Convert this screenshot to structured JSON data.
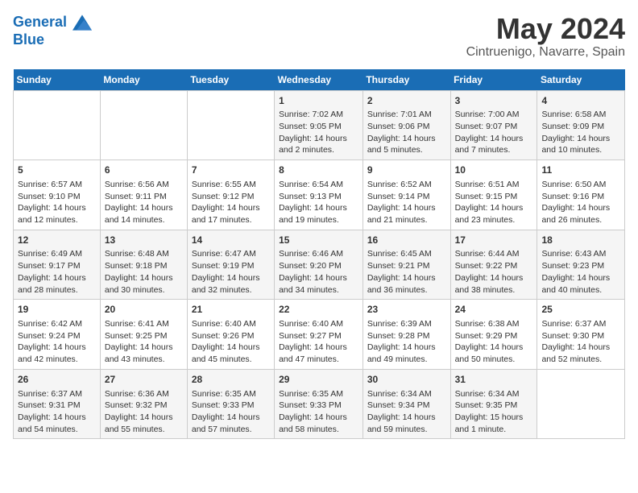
{
  "header": {
    "logo_line1": "General",
    "logo_line2": "Blue",
    "month": "May 2024",
    "location": "Cintruenigo, Navarre, Spain"
  },
  "weekdays": [
    "Sunday",
    "Monday",
    "Tuesday",
    "Wednesday",
    "Thursday",
    "Friday",
    "Saturday"
  ],
  "weeks": [
    [
      {
        "day": "",
        "content": ""
      },
      {
        "day": "",
        "content": ""
      },
      {
        "day": "",
        "content": ""
      },
      {
        "day": "1",
        "content": "Sunrise: 7:02 AM\nSunset: 9:05 PM\nDaylight: 14 hours\nand 2 minutes."
      },
      {
        "day": "2",
        "content": "Sunrise: 7:01 AM\nSunset: 9:06 PM\nDaylight: 14 hours\nand 5 minutes."
      },
      {
        "day": "3",
        "content": "Sunrise: 7:00 AM\nSunset: 9:07 PM\nDaylight: 14 hours\nand 7 minutes."
      },
      {
        "day": "4",
        "content": "Sunrise: 6:58 AM\nSunset: 9:09 PM\nDaylight: 14 hours\nand 10 minutes."
      }
    ],
    [
      {
        "day": "5",
        "content": "Sunrise: 6:57 AM\nSunset: 9:10 PM\nDaylight: 14 hours\nand 12 minutes."
      },
      {
        "day": "6",
        "content": "Sunrise: 6:56 AM\nSunset: 9:11 PM\nDaylight: 14 hours\nand 14 minutes."
      },
      {
        "day": "7",
        "content": "Sunrise: 6:55 AM\nSunset: 9:12 PM\nDaylight: 14 hours\nand 17 minutes."
      },
      {
        "day": "8",
        "content": "Sunrise: 6:54 AM\nSunset: 9:13 PM\nDaylight: 14 hours\nand 19 minutes."
      },
      {
        "day": "9",
        "content": "Sunrise: 6:52 AM\nSunset: 9:14 PM\nDaylight: 14 hours\nand 21 minutes."
      },
      {
        "day": "10",
        "content": "Sunrise: 6:51 AM\nSunset: 9:15 PM\nDaylight: 14 hours\nand 23 minutes."
      },
      {
        "day": "11",
        "content": "Sunrise: 6:50 AM\nSunset: 9:16 PM\nDaylight: 14 hours\nand 26 minutes."
      }
    ],
    [
      {
        "day": "12",
        "content": "Sunrise: 6:49 AM\nSunset: 9:17 PM\nDaylight: 14 hours\nand 28 minutes."
      },
      {
        "day": "13",
        "content": "Sunrise: 6:48 AM\nSunset: 9:18 PM\nDaylight: 14 hours\nand 30 minutes."
      },
      {
        "day": "14",
        "content": "Sunrise: 6:47 AM\nSunset: 9:19 PM\nDaylight: 14 hours\nand 32 minutes."
      },
      {
        "day": "15",
        "content": "Sunrise: 6:46 AM\nSunset: 9:20 PM\nDaylight: 14 hours\nand 34 minutes."
      },
      {
        "day": "16",
        "content": "Sunrise: 6:45 AM\nSunset: 9:21 PM\nDaylight: 14 hours\nand 36 minutes."
      },
      {
        "day": "17",
        "content": "Sunrise: 6:44 AM\nSunset: 9:22 PM\nDaylight: 14 hours\nand 38 minutes."
      },
      {
        "day": "18",
        "content": "Sunrise: 6:43 AM\nSunset: 9:23 PM\nDaylight: 14 hours\nand 40 minutes."
      }
    ],
    [
      {
        "day": "19",
        "content": "Sunrise: 6:42 AM\nSunset: 9:24 PM\nDaylight: 14 hours\nand 42 minutes."
      },
      {
        "day": "20",
        "content": "Sunrise: 6:41 AM\nSunset: 9:25 PM\nDaylight: 14 hours\nand 43 minutes."
      },
      {
        "day": "21",
        "content": "Sunrise: 6:40 AM\nSunset: 9:26 PM\nDaylight: 14 hours\nand 45 minutes."
      },
      {
        "day": "22",
        "content": "Sunrise: 6:40 AM\nSunset: 9:27 PM\nDaylight: 14 hours\nand 47 minutes."
      },
      {
        "day": "23",
        "content": "Sunrise: 6:39 AM\nSunset: 9:28 PM\nDaylight: 14 hours\nand 49 minutes."
      },
      {
        "day": "24",
        "content": "Sunrise: 6:38 AM\nSunset: 9:29 PM\nDaylight: 14 hours\nand 50 minutes."
      },
      {
        "day": "25",
        "content": "Sunrise: 6:37 AM\nSunset: 9:30 PM\nDaylight: 14 hours\nand 52 minutes."
      }
    ],
    [
      {
        "day": "26",
        "content": "Sunrise: 6:37 AM\nSunset: 9:31 PM\nDaylight: 14 hours\nand 54 minutes."
      },
      {
        "day": "27",
        "content": "Sunrise: 6:36 AM\nSunset: 9:32 PM\nDaylight: 14 hours\nand 55 minutes."
      },
      {
        "day": "28",
        "content": "Sunrise: 6:35 AM\nSunset: 9:33 PM\nDaylight: 14 hours\nand 57 minutes."
      },
      {
        "day": "29",
        "content": "Sunrise: 6:35 AM\nSunset: 9:33 PM\nDaylight: 14 hours\nand 58 minutes."
      },
      {
        "day": "30",
        "content": "Sunrise: 6:34 AM\nSunset: 9:34 PM\nDaylight: 14 hours\nand 59 minutes."
      },
      {
        "day": "31",
        "content": "Sunrise: 6:34 AM\nSunset: 9:35 PM\nDaylight: 15 hours\nand 1 minute."
      },
      {
        "day": "",
        "content": ""
      }
    ]
  ]
}
